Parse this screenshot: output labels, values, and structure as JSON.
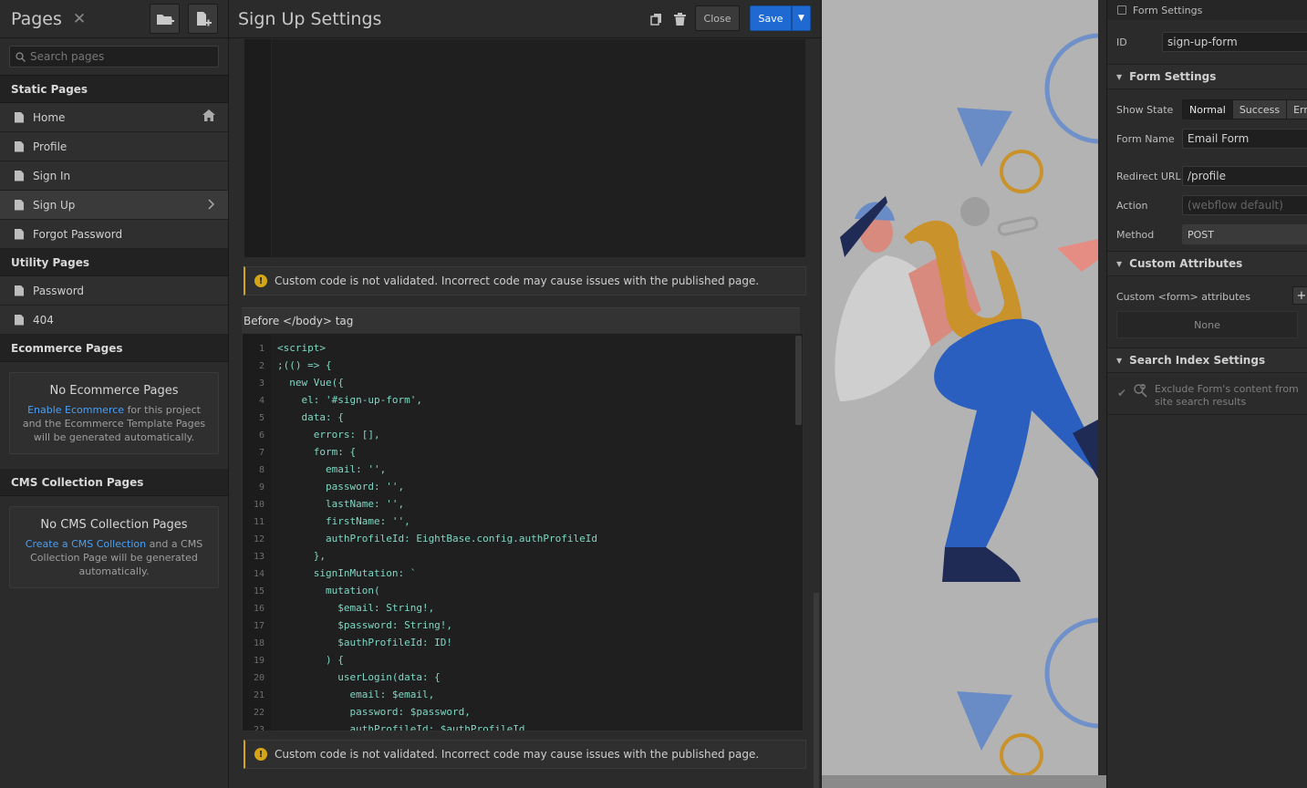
{
  "pages_panel": {
    "title": "Pages",
    "close_icon": "close-icon",
    "search_placeholder": "Search pages",
    "sections": {
      "static": {
        "title": "Static Pages",
        "items": [
          {
            "label": "Home",
            "trail_icon": "home-icon"
          },
          {
            "label": "Profile"
          },
          {
            "label": "Sign In"
          },
          {
            "label": "Sign Up",
            "trail_icon": "chevron-right-icon",
            "active": true
          },
          {
            "label": "Forgot Password"
          }
        ]
      },
      "utility": {
        "title": "Utility Pages",
        "items": [
          {
            "label": "Password"
          },
          {
            "label": "404"
          }
        ]
      },
      "ecommerce": {
        "title": "Ecommerce Pages",
        "empty_title": "No Ecommerce Pages",
        "link": "Enable Ecommerce",
        "text": "for this project and the Ecommerce Template Pages will be generated automatically."
      },
      "cms": {
        "title": "CMS Collection Pages",
        "empty_title": "No CMS Collection Pages",
        "link": "Create a CMS Collection",
        "text": "and a CMS Collection Page will be generated automatically."
      }
    }
  },
  "settings": {
    "title": "Sign Up Settings",
    "close_label": "Close",
    "save_label": "Save",
    "warning": "Custom code is not validated. Incorrect code may cause issues with the published page.",
    "before_body_label": "Before </body> tag",
    "code_lines": [
      "<script>",
      ";(() => {",
      "  new Vue({",
      "    el: '#sign-up-form',",
      "    data: {",
      "      errors: [],",
      "      form: {",
      "        email: '',",
      "        password: '',",
      "        lastName: '',",
      "        firstName: '',",
      "        authProfileId: EightBase.config.authProfileId",
      "      },",
      "      signInMutation: `",
      "        mutation(",
      "          $email: String!,",
      "          $password: String!,",
      "          $authProfileId: ID!",
      "        ) {",
      "          userLogin(data: {",
      "            email: $email,",
      "            password: $password,",
      "            authProfileId: $authProfileId"
    ]
  },
  "props": {
    "top_label": "Form Settings",
    "id_label": "ID",
    "id_value": "sign-up-form",
    "form_settings_title": "Form Settings",
    "show_state_label": "Show State",
    "states": [
      "Normal",
      "Success",
      "Erro"
    ],
    "form_name_label": "Form Name",
    "form_name_value": "Email Form",
    "redirect_label": "Redirect URL",
    "redirect_value": "/profile",
    "action_label": "Action",
    "action_placeholder": "(webflow default)",
    "method_label": "Method",
    "method_value": "POST",
    "custom_attrs_title": "Custom Attributes",
    "custom_form_attrs_label": "Custom <form> attributes",
    "none_label": "None",
    "search_index_title": "Search Index Settings",
    "exclude_text": "Exclude Form's content from site search results"
  },
  "colors": {
    "accent": "#1e6ad2",
    "link": "#4a9ff5",
    "warning": "#d4a617",
    "code_text": "#7fd7c3"
  }
}
